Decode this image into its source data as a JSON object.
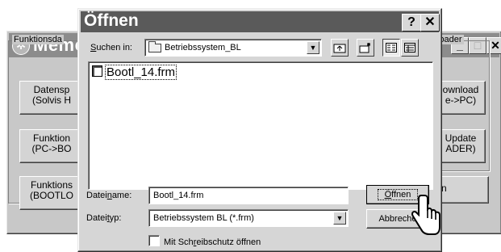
{
  "background_window": {
    "title": "Memo",
    "app_icon": "gear-icon",
    "controls": {
      "minimize": "_",
      "maximize": "□",
      "close": "✕"
    },
    "left_group": {
      "label": "Funktionsda",
      "buttons": [
        {
          "line1": "Datensp",
          "line2": "(Solvis H"
        },
        {
          "line1": "Funktion",
          "line2": "(PC->BO"
        },
        {
          "line1": "Funktions",
          "line2": "(BOOTLO"
        }
      ]
    },
    "right_group": {
      "label": "loader",
      "buttons": [
        {
          "line1": "ownload",
          "line2": "e->PC)"
        },
        {
          "line1": "Update",
          "line2": "ADER)"
        },
        {
          "line1": "n",
          "line2": ""
        }
      ]
    }
  },
  "dialog": {
    "title": "Öffnen",
    "controls": {
      "help": "?",
      "close": "✕"
    },
    "look_in": {
      "label_prefix": "",
      "label_underlined": "S",
      "label_rest": "uchen in:",
      "value": "Betriebssystem_BL",
      "icon": "folder-icon"
    },
    "toolbar": {
      "up_icon": "folder-up-icon",
      "new_folder_icon": "new-folder-icon",
      "list_view_icon": "list-view-icon",
      "details_view_icon": "details-view-icon"
    },
    "files": [
      {
        "name": "Bootl_14.frm",
        "icon": "file-icon",
        "selected": true
      }
    ],
    "filename": {
      "label_prefix": "Datei",
      "label_underlined": "n",
      "label_rest": "ame:",
      "value": "Bootl_14.frm"
    },
    "filetype": {
      "label_prefix": "Datei",
      "label_underlined": "t",
      "label_rest": "yp:",
      "value": "Betriebssystem BL (*.frm)"
    },
    "open_button": {
      "prefix": "",
      "underlined": "Ö",
      "rest": "ffnen"
    },
    "cancel_button": "Abbreche",
    "readonly_checkbox": {
      "prefix": "Mit Sch",
      "underlined": "r",
      "rest": "eibschutz öffnen",
      "checked": false
    }
  }
}
